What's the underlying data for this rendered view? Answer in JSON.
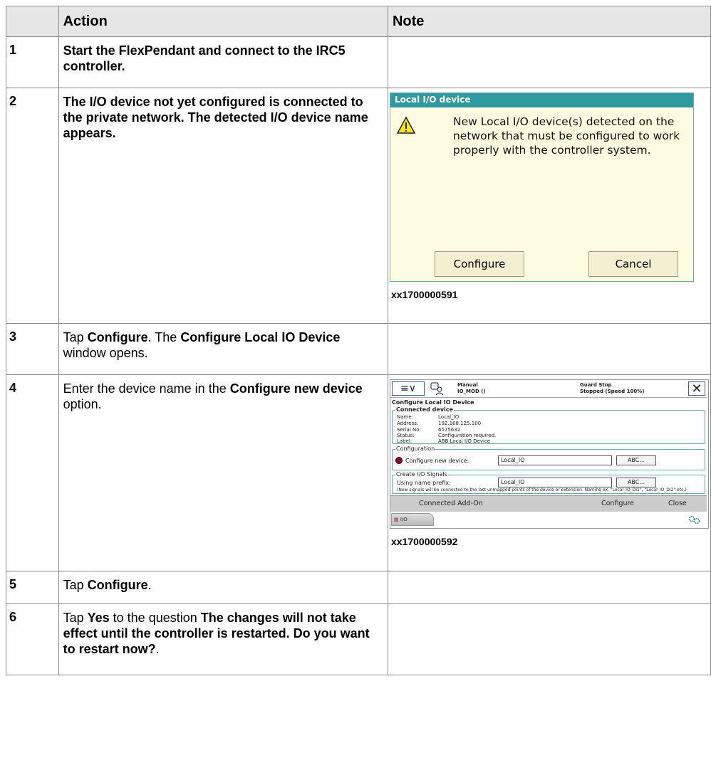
{
  "table": {
    "headers": [
      "",
      "Action",
      "Note"
    ],
    "rows": [
      {
        "num": "1",
        "action": "Start the FlexPendant and connect to the IRC5 controller."
      },
      {
        "num": "2",
        "action": "The I/O device not yet configured is connected to the private network. The detected I/O device name appears."
      },
      {
        "num": "3",
        "action_parts": [
          "Tap ",
          "Configure",
          ". The ",
          "Configure Local IO Device",
          " window opens."
        ]
      },
      {
        "num": "4",
        "action_parts": [
          "Enter the device name in the ",
          "Configure new device",
          " option."
        ]
      },
      {
        "num": "5",
        "action_parts": [
          "Tap ",
          "Configure",
          "."
        ]
      },
      {
        "num": "6",
        "action_parts": [
          "Tap ",
          "Yes",
          " to the question ",
          "The changes will not take effect until the controller is restarted. Do you want to restart now?",
          "."
        ]
      }
    ]
  },
  "figure1": {
    "id": "xx1700000591",
    "title": "Local I/O device",
    "message": "New Local I/O device(s) detected on the network that must be configured to work properly with the controller system.",
    "icon": "warning-icon",
    "buttons": {
      "configure": "Configure",
      "cancel": "Cancel"
    },
    "colors": {
      "title_bar": "#2e9aa0",
      "background": "#fdfbe0"
    }
  },
  "figure2": {
    "id": "xx1700000592",
    "status": {
      "mode": "Manual",
      "module": "IO_MOD ()",
      "state": "Guard Stop",
      "speed": "Stopped (Speed 100%)"
    },
    "window_title": "Configure Local IO Device",
    "connected_device": {
      "title": "Connected device",
      "fields": [
        {
          "k": "Name:",
          "v": "Local_IO"
        },
        {
          "k": "Address:",
          "v": "192.168.125.100"
        },
        {
          "k": "Serial No:",
          "v": "6575632"
        },
        {
          "k": "Status:",
          "v": "Configuration required."
        },
        {
          "k": "Label:",
          "v": "ABB Local I/O Device"
        }
      ]
    },
    "configuration": {
      "title": "Configuration",
      "option": "Configure new device:",
      "value": "Local_IO",
      "abc": "ABC..."
    },
    "signals": {
      "title": "Create I/O Signals",
      "label": "Using name prefix:",
      "value": "Local_IO",
      "abc": "ABC...",
      "note": "(New signals will be connected to the last unmapped points of the device or extension. Naming ex. \"Local_IO_DI1\", \"Local_IO_DI2\" etc.)"
    },
    "commands": {
      "addon": "Connected Add-On",
      "configure": "Configure",
      "close": "Close"
    },
    "tab": "I/O"
  }
}
